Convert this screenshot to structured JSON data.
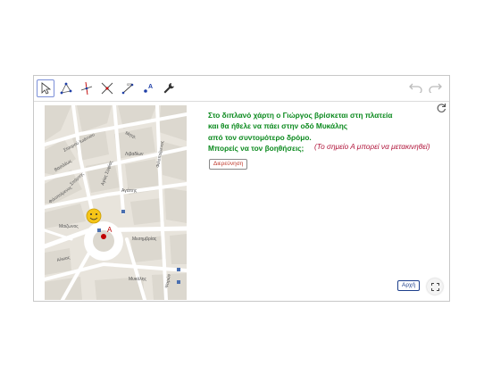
{
  "toolbar": {
    "tools": [
      "move-tool",
      "polygon-tool",
      "perpendicular-line-tool",
      "intersect-tool",
      "distance-tool",
      "text-tool",
      "settings-tool"
    ]
  },
  "map": {
    "streets": [
      "Μητρ.",
      "Σταυρού Ιωάννου",
      "Βασιλέως",
      "Λιβαδίων",
      "Φιλοποίμενος",
      "Αγίας Σοφίας",
      "Αγάπης",
      "Σπάρτης",
      "Φιλοποίμενος",
      "Μαιζωνος",
      "Μεσημβρίας",
      "Αλκιας",
      "Μυκάλης",
      "Ψαρών"
    ],
    "point_label": "A",
    "point_color": "#c00000"
  },
  "content": {
    "line1": "Στο διπλανό χάρτη ο Γιώργος βρίσκεται στη πλατεία",
    "line2": "και θα ήθελε να πάει στην οδό Μυκάλης",
    "line3": "από τον συντομότερο δρόμο.",
    "line4": "Μπορείς να τον βοηθήσεις;",
    "note": "(Το σημείο Α μπορεί να μετακινηθεί)",
    "instructions_button": "Διερεύνηση",
    "start_button": "Αρχή"
  },
  "colors": {
    "text_green": "#0b8a1e",
    "note_red": "#b0143a"
  }
}
